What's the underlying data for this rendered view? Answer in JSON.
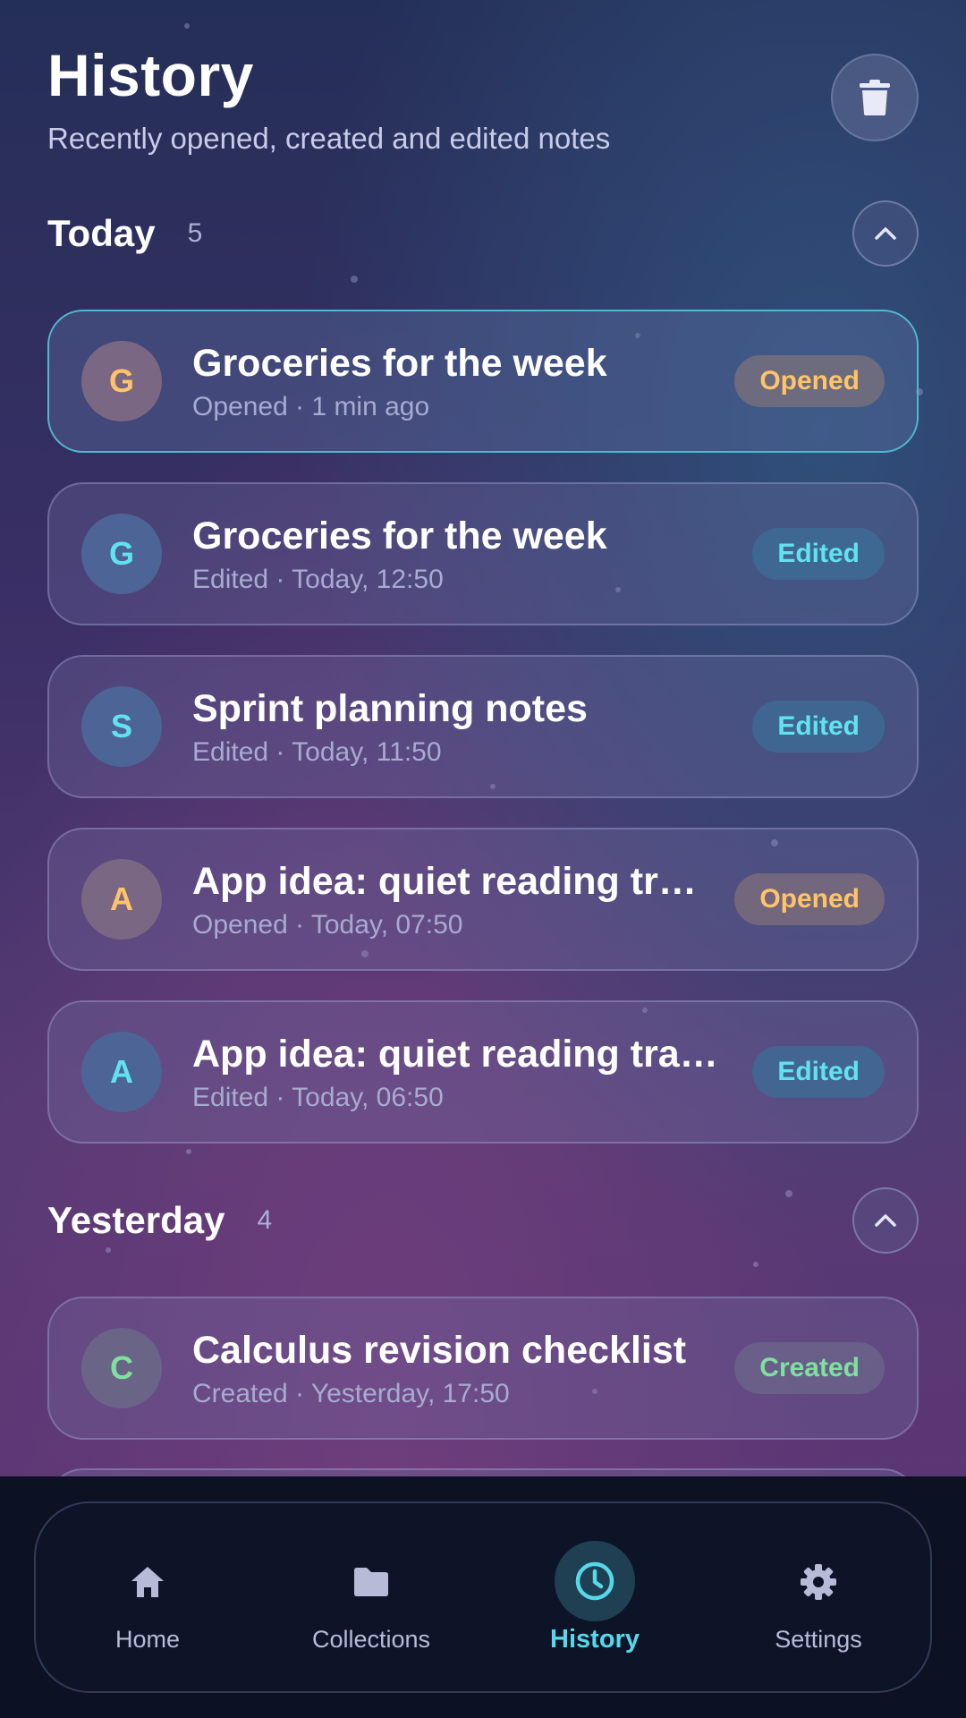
{
  "header": {
    "title": "History",
    "subtitle": "Recently opened, created and edited notes"
  },
  "sections": [
    {
      "title": "Today",
      "count": "5",
      "items": [
        {
          "initial": "G",
          "title": "Groceries for the week",
          "meta": "Opened · 1 min ago",
          "badge": "Opened"
        },
        {
          "initial": "G",
          "title": "Groceries for the week",
          "meta": "Edited · Today, 12:50",
          "badge": "Edited"
        },
        {
          "initial": "S",
          "title": "Sprint planning notes",
          "meta": "Edited · Today, 11:50",
          "badge": "Edited"
        },
        {
          "initial": "A",
          "title": "App idea: quiet reading tracker",
          "meta": "Opened · Today, 07:50",
          "badge": "Opened"
        },
        {
          "initial": "A",
          "title": "App idea: quiet reading tracker",
          "meta": "Edited · Today, 06:50",
          "badge": "Edited"
        }
      ]
    },
    {
      "title": "Yesterday",
      "count": "4",
      "items": [
        {
          "initial": "C",
          "title": "Calculus revision checklist",
          "meta": "Created · Yesterday, 17:50",
          "badge": "Created"
        }
      ]
    }
  ],
  "nav": {
    "items": [
      {
        "label": "Home",
        "icon": "home-icon"
      },
      {
        "label": "Collections",
        "icon": "folder-icon"
      },
      {
        "label": "History",
        "icon": "clock-icon",
        "active": true
      },
      {
        "label": "Settings",
        "icon": "gear-icon"
      }
    ]
  },
  "colors": {
    "accent": "#56d8ea",
    "opened": "#ffc36b",
    "edited": "#62e2ee",
    "created": "#7fe0a0"
  }
}
